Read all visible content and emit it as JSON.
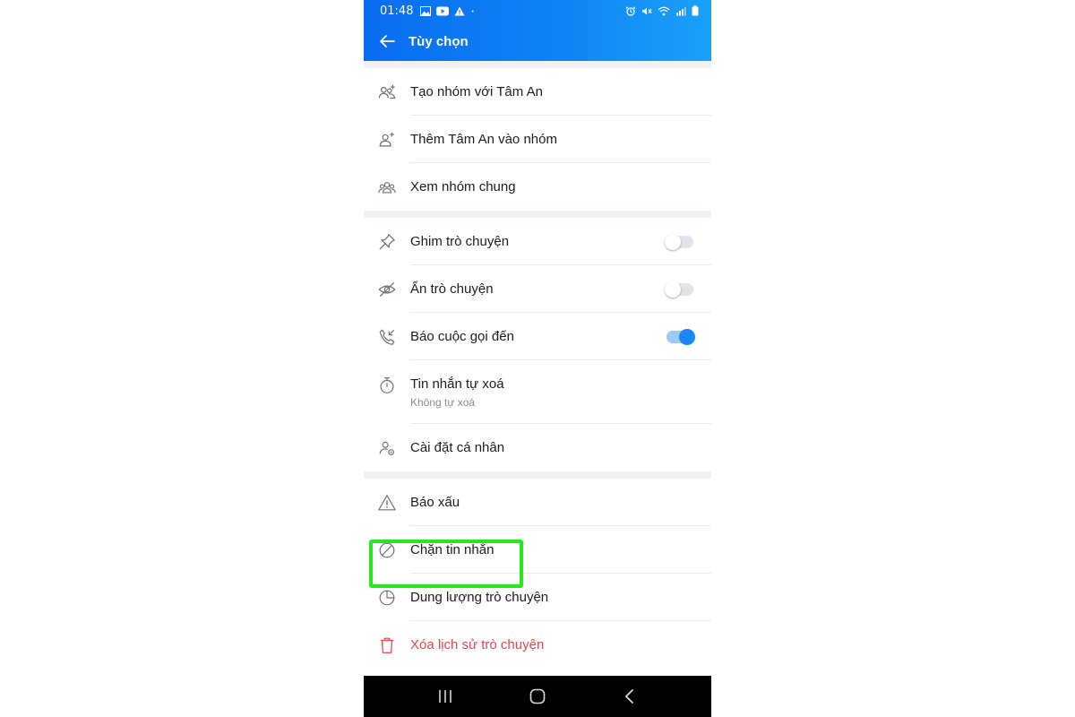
{
  "status_bar": {
    "time": "01:48",
    "left_icons": [
      "image-icon",
      "youtube-icon",
      "warning-icon",
      "dot-icon"
    ],
    "right_icons": [
      "alarm-icon",
      "mute-icon",
      "wifi-icon",
      "signal-icon",
      "battery-icon"
    ]
  },
  "header": {
    "title": "Tùy chọn",
    "back_icon": "arrow-left-icon"
  },
  "sections": [
    [
      {
        "id": "create-group",
        "label": "Tạo nhóm với Tâm An",
        "icon": "group-add-icon"
      },
      {
        "id": "add-to-group",
        "label": "Thêm Tâm An vào nhóm",
        "icon": "person-add-icon"
      },
      {
        "id": "view-common-groups",
        "label": "Xem nhóm chung",
        "icon": "group-icon"
      }
    ],
    [
      {
        "id": "pin-chat",
        "label": "Ghim trò chuyện",
        "icon": "pin-icon",
        "toggle": false
      },
      {
        "id": "hide-chat",
        "label": "Ẩn trò chuyện",
        "icon": "eye-off-icon",
        "toggle": false
      },
      {
        "id": "incoming-call-alert",
        "label": "Báo cuộc gọi đến",
        "icon": "incoming-call-icon",
        "toggle": true
      },
      {
        "id": "self-destruct",
        "label": "Tin nhắn tự xoá",
        "sublabel": "Không tự xoá",
        "icon": "timer-icon"
      },
      {
        "id": "personal-settings",
        "label": "Cài đặt cá nhân",
        "icon": "person-settings-icon"
      }
    ],
    [
      {
        "id": "report",
        "label": "Báo xấu",
        "icon": "warning-triangle-icon"
      },
      {
        "id": "block-messages",
        "label": "Chặn tin nhắn",
        "icon": "block-icon"
      },
      {
        "id": "chat-storage",
        "label": "Dung lượng trò chuyện",
        "icon": "pie-chart-icon"
      },
      {
        "id": "delete-history",
        "label": "Xóa lịch sử trò chuyện",
        "icon": "trash-icon",
        "danger": true
      }
    ]
  ],
  "colors": {
    "header_blue": "#0f86f5",
    "toggle_on": "#1b86f3",
    "danger": "#e5484d",
    "highlight": "#27e81c"
  },
  "nav_bar": {
    "buttons": [
      "recent-apps-icon",
      "home-icon",
      "back-icon"
    ]
  }
}
